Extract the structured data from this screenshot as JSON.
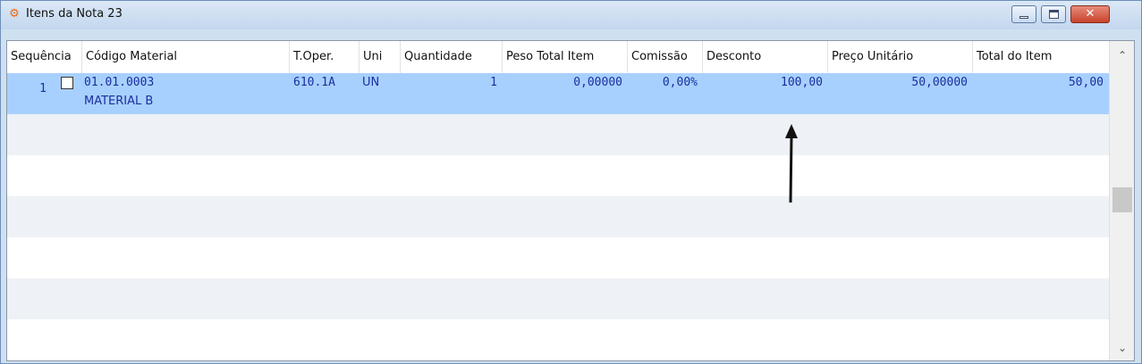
{
  "window": {
    "title": "Itens da Nota 23",
    "icon": "app-icon",
    "close_label": "✕"
  },
  "grid": {
    "columns": [
      "Sequência",
      "Código Material",
      "T.Oper.",
      "Uni",
      "Quantidade",
      "Peso Total Item",
      "Comissão",
      "Desconto",
      "Preço Unitário",
      "Total do Item"
    ],
    "rows": [
      {
        "sequencia": "1",
        "codigo": "01.01.0003",
        "descricao": "MATERIAL B",
        "toper": "610.1A",
        "uni": "UN",
        "quantidade": "1",
        "peso": "0,00000",
        "comissao": "0,00%",
        "desconto": "100,00",
        "preco": "50,00000",
        "total": "50,00"
      }
    ]
  },
  "colors": {
    "selected_row": "#a8d0ff",
    "text_blue": "#1a2f9e",
    "stripe": "#eef1f5"
  }
}
